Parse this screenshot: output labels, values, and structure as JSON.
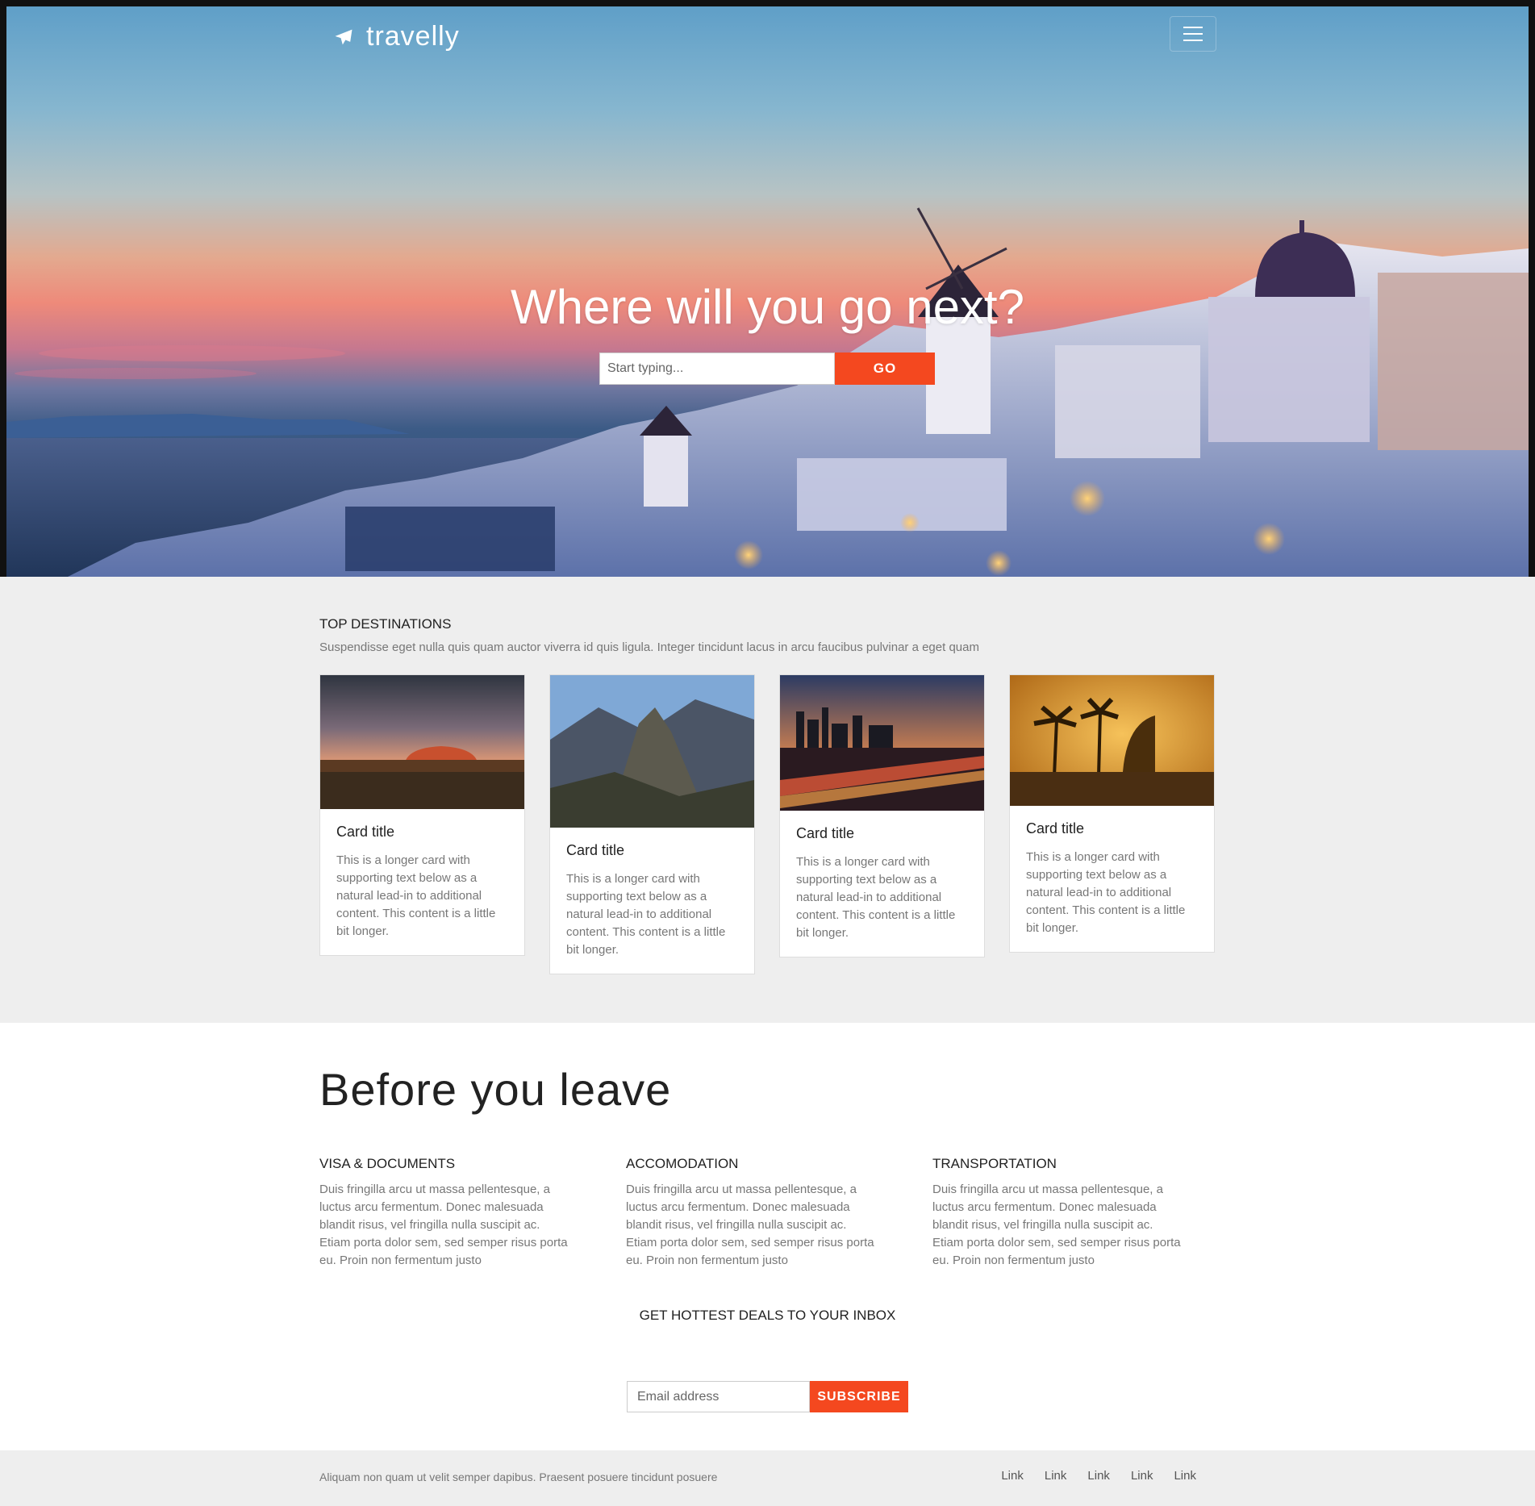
{
  "header": {
    "brand": "travelly",
    "menu_icon": "hamburger-icon",
    "brand_icon": "airplane-icon"
  },
  "hero": {
    "title": "Where will you go next?",
    "search_placeholder": "Start typing...",
    "go_label": "GO"
  },
  "destinations": {
    "heading": "TOP DESTINATIONS",
    "subtitle": "Suspendisse eget nulla quis quam auctor viverra id quis ligula. Integer tincidunt lacus in arcu faucibus pulvinar a eget quam",
    "cards": [
      {
        "title": "Card title",
        "text": "This is a longer card with supporting text below as a natural lead-in to additional content. This content is a little bit longer."
      },
      {
        "title": "Card title",
        "text": "This is a longer card with supporting text below as a natural lead-in to additional content. This content is a little bit longer."
      },
      {
        "title": "Card title",
        "text": "This is a longer card with supporting text below as a natural lead-in to additional content. This content is a little bit longer."
      },
      {
        "title": "Card title",
        "text": "This is a longer card with supporting text below as a natural lead-in to additional content. This content is a little bit longer."
      }
    ]
  },
  "leave": {
    "heading": "Before you leave",
    "columns": [
      {
        "title": "VISA & DOCUMENTS",
        "text": "Duis fringilla arcu ut massa pellentesque, a luctus arcu fermentum. Donec malesuada blandit risus, vel fringilla nulla suscipit ac. Etiam porta dolor sem, sed semper risus porta eu. Proin non fermentum justo"
      },
      {
        "title": "ACCOMODATION",
        "text": "Duis fringilla arcu ut massa pellentesque, a luctus arcu fermentum. Donec malesuada blandit risus, vel fringilla nulla suscipit ac. Etiam porta dolor sem, sed semper risus porta eu. Proin non fermentum justo"
      },
      {
        "title": "TRANSPORTATION",
        "text": "Duis fringilla arcu ut massa pellentesque, a luctus arcu fermentum. Donec malesuada blandit risus, vel fringilla nulla suscipit ac. Etiam porta dolor sem, sed semper risus porta eu. Proin non fermentum justo"
      }
    ],
    "deals_heading": "GET HOTTEST DEALS TO YOUR INBOX",
    "email_placeholder": "Email address",
    "subscribe_label": "SUBSCRIBE"
  },
  "footer": {
    "note": "Aliquam non quam ut velit semper dapibus. Praesent posuere tincidunt posuere",
    "links": [
      "Link",
      "Link",
      "Link",
      "Link",
      "Link"
    ]
  },
  "colors": {
    "accent": "#f4481f",
    "section_bg": "#eeeeee"
  }
}
